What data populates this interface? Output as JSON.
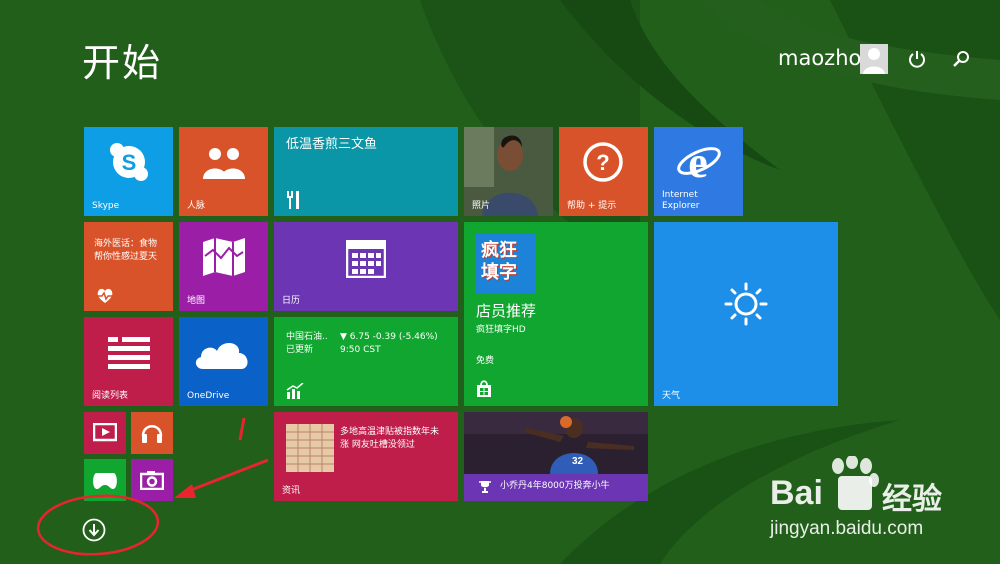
{
  "screen": {
    "title": "开始",
    "user_name": "maozhong"
  },
  "icons": {
    "power": "power-icon",
    "search": "search-icon",
    "apps": "arrow-down-circle-icon",
    "user": "user-avatar-icon"
  },
  "tiles": {
    "skype": {
      "label": "Skype",
      "color": "#0e9ee6"
    },
    "people": {
      "label": "人脉",
      "color": "#d9532a"
    },
    "food": {
      "title": "低温香煎三文鱼",
      "color": "#0a96a6"
    },
    "photos": {
      "label": "照片"
    },
    "help": {
      "label": "帮助 + 提示",
      "color": "#d9532a"
    },
    "ie": {
      "label_line1": "Internet",
      "label_line2": "Explorer",
      "color": "#2f79e3"
    },
    "health": {
      "text_line1": "海外医话：食物",
      "text_line2": "帮你性感过夏天",
      "color": "#d9532a"
    },
    "maps": {
      "label": "地图",
      "color": "#9a1fa6"
    },
    "calendar": {
      "label": "日历",
      "color": "#6b35b4"
    },
    "store": {
      "logo_line1": "疯狂",
      "logo_line2": "填字",
      "title": "店员推荐",
      "app": "疯狂填字HD",
      "price": "免费",
      "color": "#11a630"
    },
    "weather": {
      "label": "天气",
      "color": "#1e8fe8"
    },
    "reading": {
      "label": "阅读列表",
      "color": "#bf1e4b"
    },
    "onedrive": {
      "label": "OneDrive",
      "color": "#0a62c8"
    },
    "finance": {
      "name_line1": "中国石油..",
      "name_line2": "已更新",
      "change": "▼ 6.75 -0.39 (-5.46%)",
      "time": "9:50 CST",
      "color": "#11a630"
    },
    "video": {
      "color": "#bf1e4b"
    },
    "music": {
      "color": "#d9532a"
    },
    "games": {
      "color": "#11a630"
    },
    "camera": {
      "color": "#9a1fa6"
    },
    "news": {
      "text_line1": "多地高温津贴被指数年未",
      "text_line2": "涨 网友吐槽没领过",
      "label": "资讯",
      "color": "#bf1e4b"
    },
    "sports": {
      "caption": "小乔丹4年8000万投奔小牛",
      "color": "#6b35b4"
    }
  },
  "watermark": {
    "brand_left": "Bai",
    "brand_right": "经验",
    "url": "jingyan.baidu.com"
  }
}
